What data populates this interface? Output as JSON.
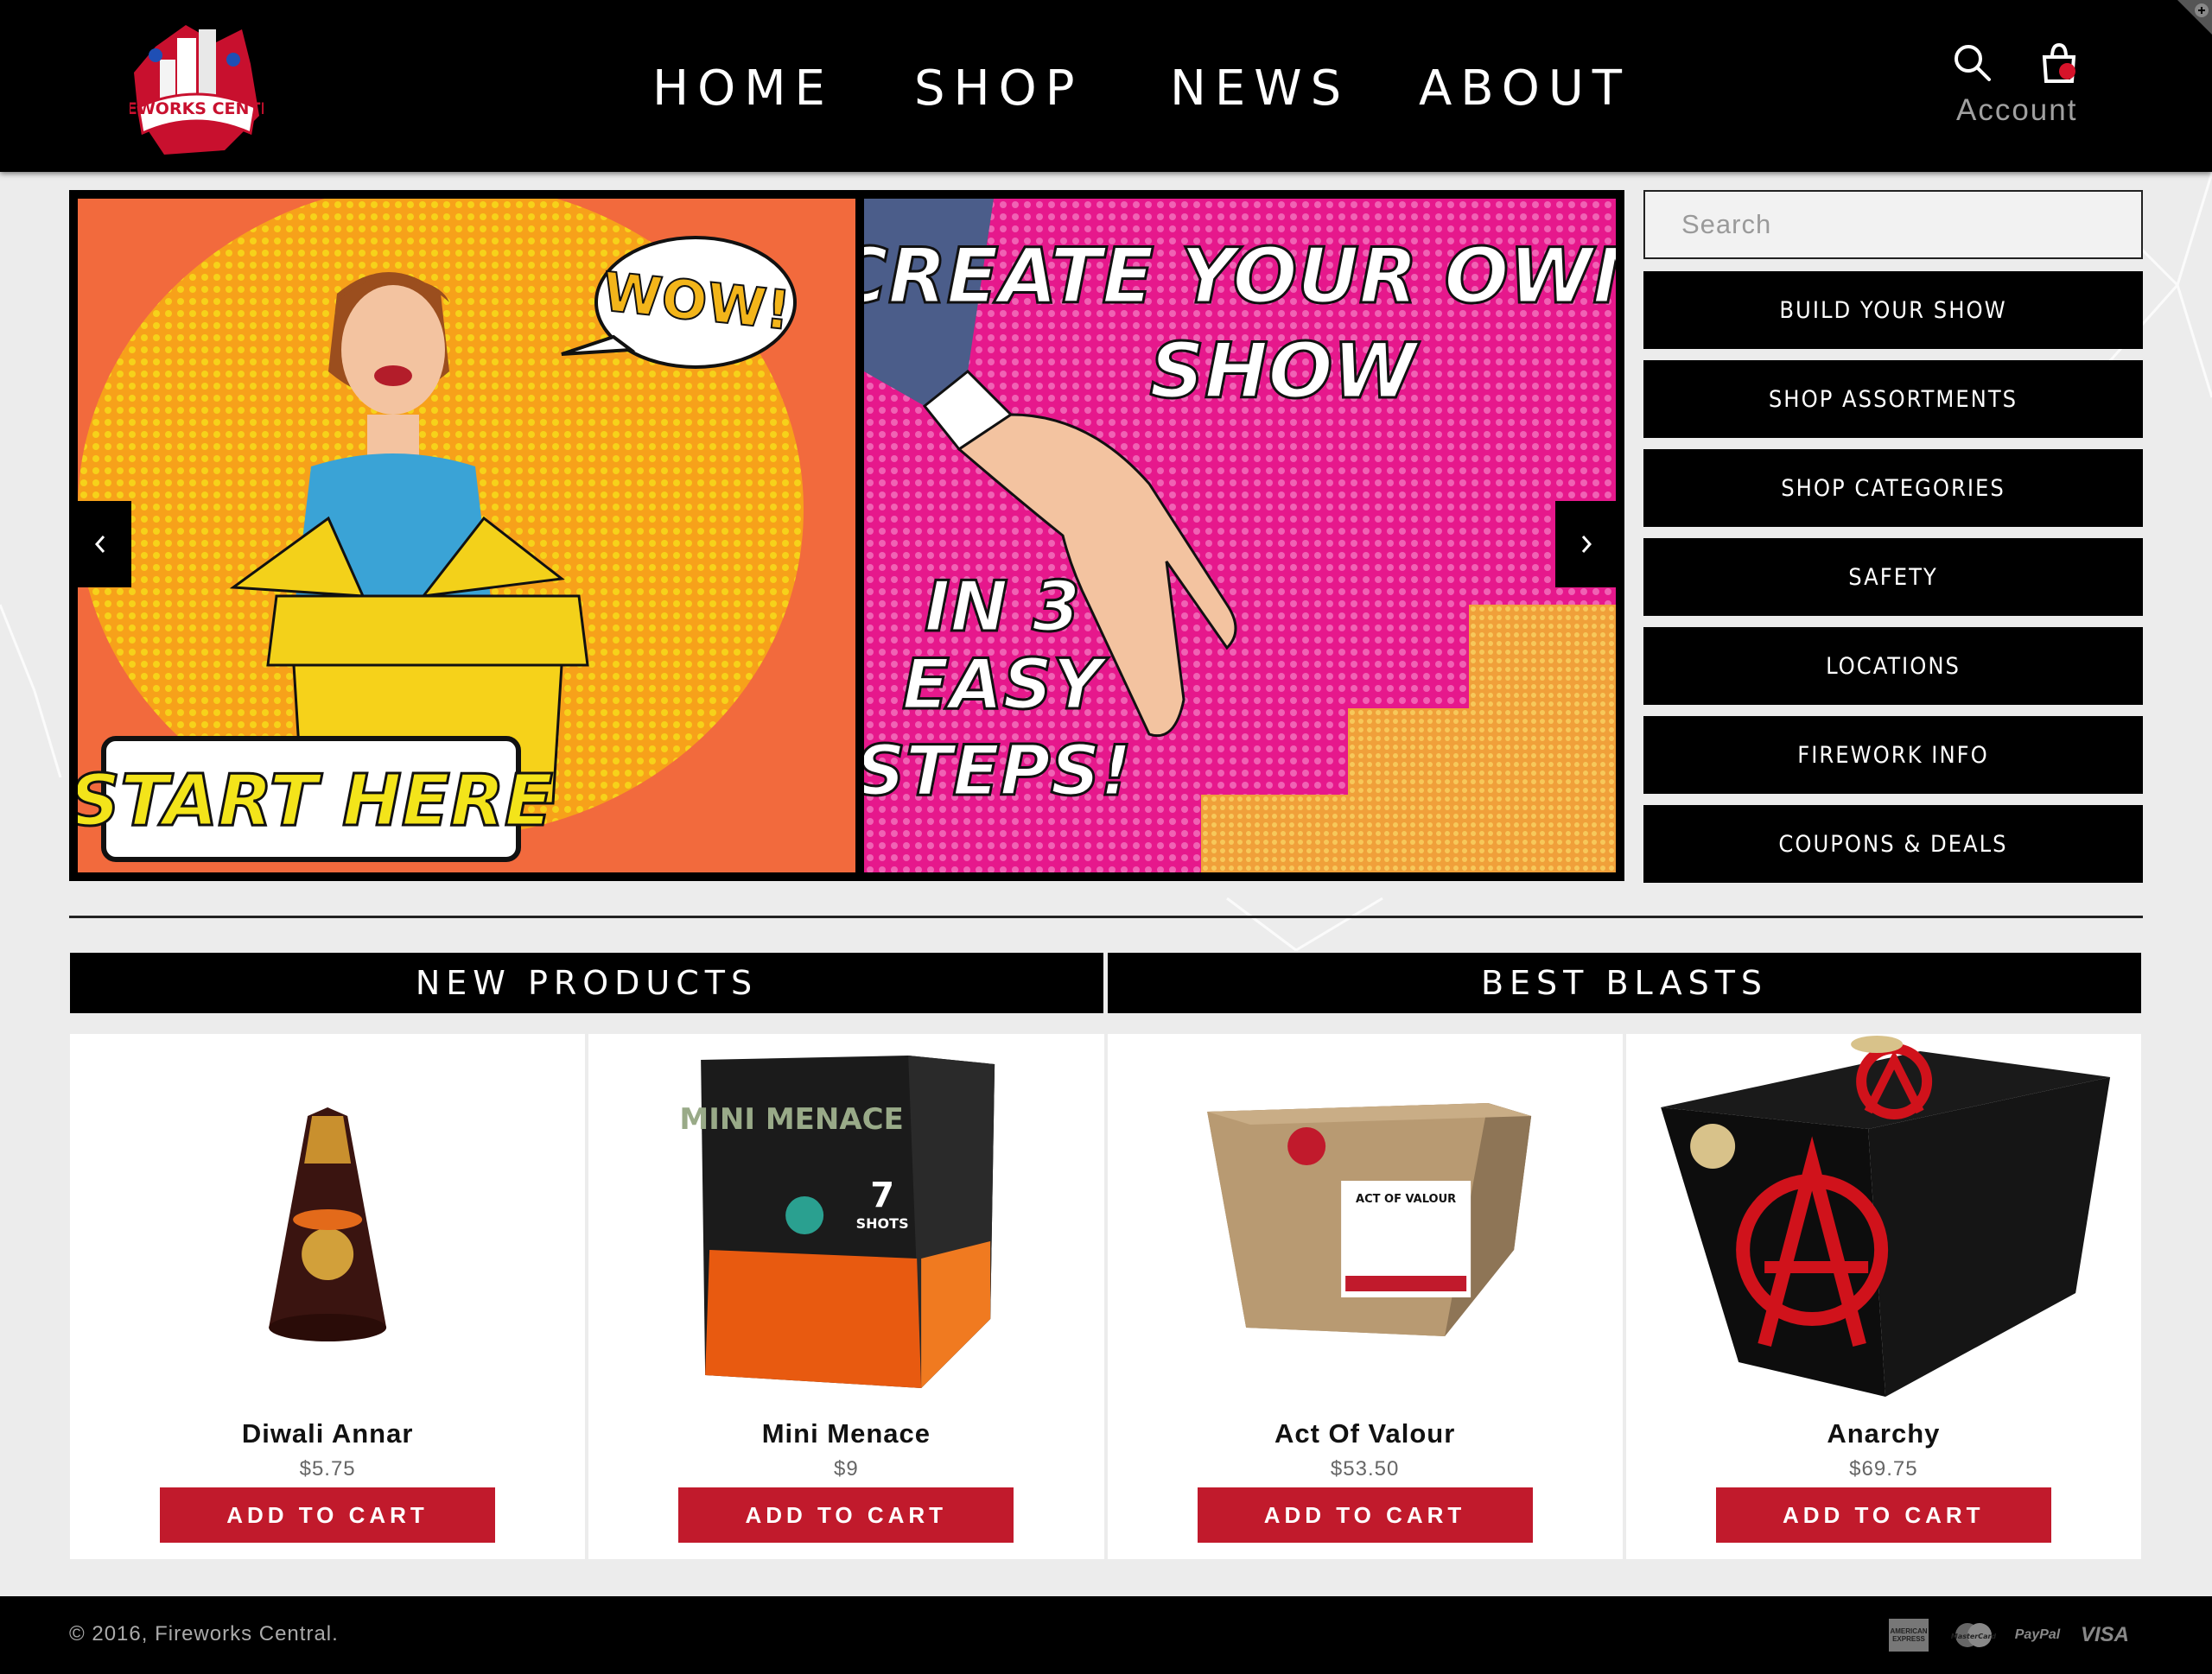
{
  "header": {
    "brand": "FIREWORKS CENTRAL",
    "nav": [
      "HOME",
      "SHOP",
      "NEWS",
      "ABOUT"
    ],
    "account_label": "Account"
  },
  "slider": {
    "left_bubble": "WOW!",
    "left_cta": "START HERE",
    "right_title_1": "CREATE YOUR OWN",
    "right_title_2": "SHOW",
    "right_steps_1": "IN 3",
    "right_steps_2": "EASY",
    "right_steps_3": "STEPS!"
  },
  "sidebar": {
    "search_placeholder": "Search",
    "buttons": [
      "BUILD YOUR SHOW",
      "SHOP ASSORTMENTS",
      "SHOP CATEGORIES",
      "SAFETY",
      "LOCATIONS",
      "FIREWORK INFO",
      "COUPONS & DEALS"
    ]
  },
  "tabs": [
    "NEW PRODUCTS",
    "BEST BLASTS"
  ],
  "products": [
    {
      "name": "Diwali Annar",
      "price": "$5.75",
      "cta": "ADD TO CART"
    },
    {
      "name": "Mini Menace",
      "price": "$9",
      "cta": "ADD TO CART"
    },
    {
      "name": "Act Of Valour",
      "price": "$53.50",
      "cta": "ADD TO CART"
    },
    {
      "name": "Anarchy",
      "price": "$69.75",
      "cta": "ADD TO CART"
    }
  ],
  "product_art": {
    "mini_menace_title": "MINI MENACE",
    "mini_menace_shots": "7",
    "mini_menace_shots_label": "SHOTS",
    "act_of_valour_label": "ACT OF VALOUR"
  },
  "footer": {
    "copyright": "© 2016, Fireworks Central.",
    "payments": [
      "AMERICAN EXPRESS",
      "MasterCard",
      "PayPal",
      "VISA"
    ]
  },
  "colors": {
    "accent": "#c11a2c",
    "header_bg": "#000000",
    "page_bg": "#ececec"
  }
}
